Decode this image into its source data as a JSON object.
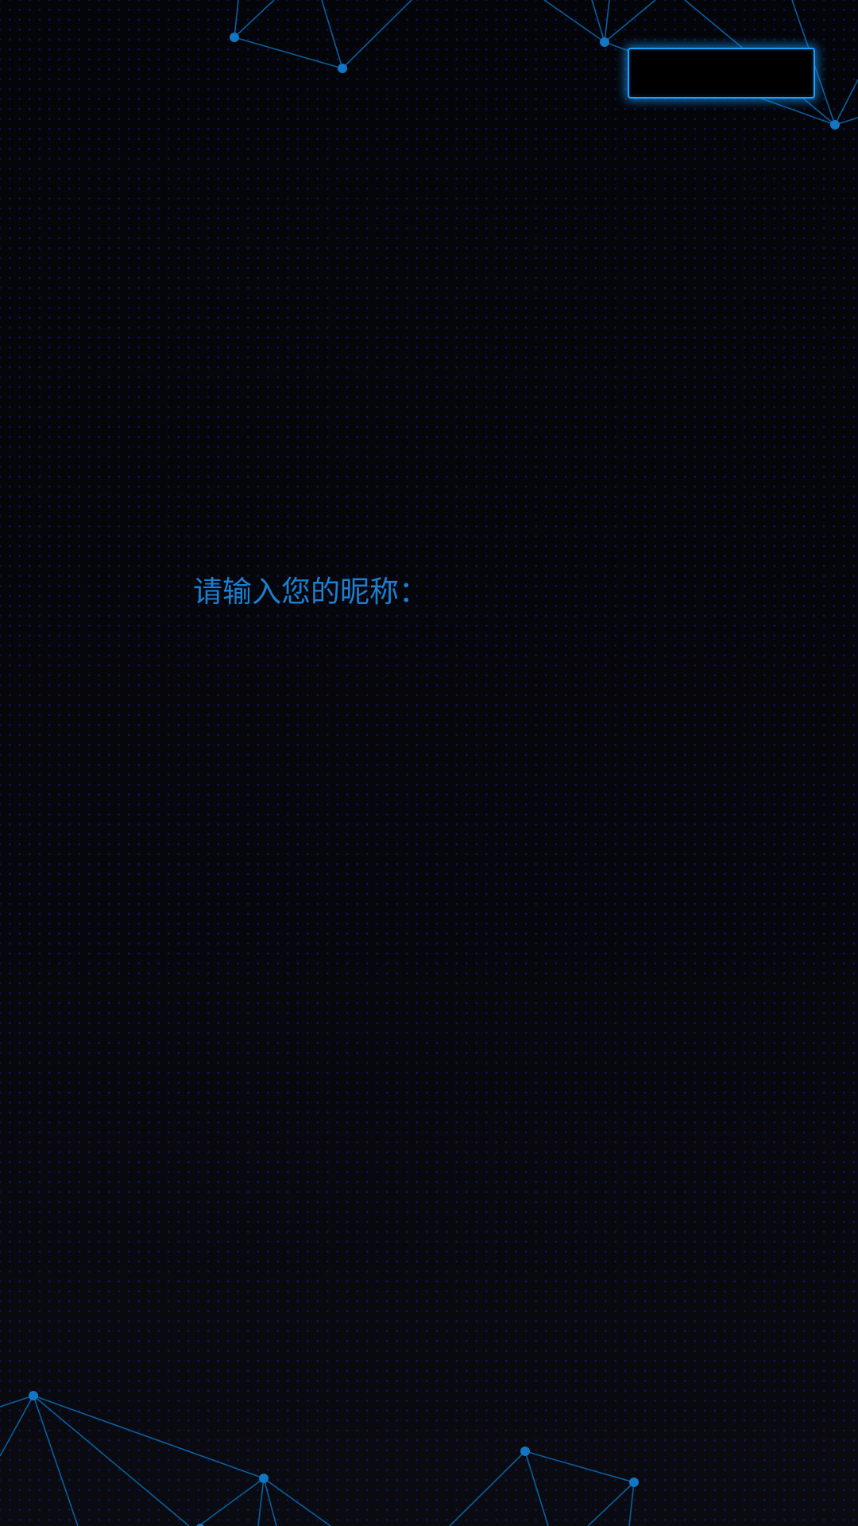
{
  "nickname_prompt": {
    "label": "请输入您的昵称："
  },
  "top_button": {
    "label": ""
  },
  "theme": {
    "background": "#05060b",
    "dot_grid": "#141e96",
    "network_line": "#0a5f9e",
    "network_node": "#1276c2",
    "text_accent": "#1c7fcf",
    "button_glow": "#1aa0ff"
  }
}
